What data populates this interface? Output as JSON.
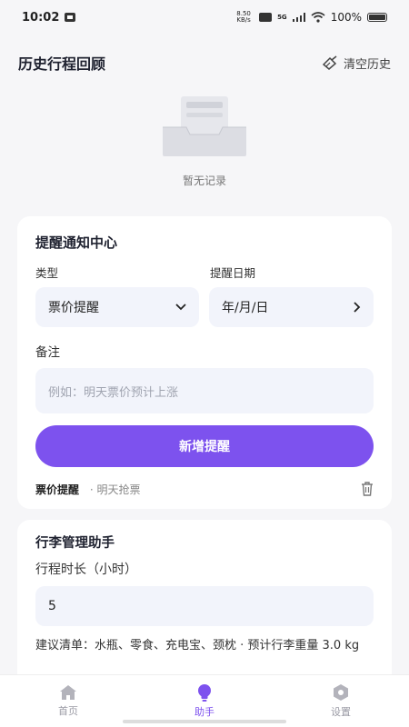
{
  "status_bar": {
    "time": "10:02",
    "network_speed": "8.50 KB/s",
    "network_type": "5G",
    "battery": "100%"
  },
  "header": {
    "title": "历史行程回顾",
    "clear_label": "清空历史"
  },
  "empty_state": {
    "text": "暂无记录"
  },
  "reminder_card": {
    "title": "提醒通知中心",
    "type_label": "类型",
    "type_value": "票价提醒",
    "date_label": "提醒日期",
    "date_value": "年/月/日",
    "note_label": "备注",
    "note_placeholder": "例如：明天票价预计上涨",
    "add_button": "新增提醒",
    "item": {
      "type": "票价提醒",
      "note": "· 明天抢票"
    }
  },
  "luggage_card": {
    "title": "行李管理助手",
    "duration_label": "行程时长（小时）",
    "duration_value": "5",
    "suggestion": "建议清单：水瓶、零食、充电宝、颈枕 · 预计行李重量 3.0 kg"
  },
  "bottom_nav": {
    "items": [
      {
        "label": "首页",
        "icon": "home-icon",
        "active": false
      },
      {
        "label": "助手",
        "icon": "lightbulb-icon",
        "active": true
      },
      {
        "label": "设置",
        "icon": "settings-icon",
        "active": false
      }
    ]
  },
  "colors": {
    "accent": "#7d52ee",
    "field_bg": "#f2f4fb",
    "page_bg": "#f6f6f8"
  }
}
